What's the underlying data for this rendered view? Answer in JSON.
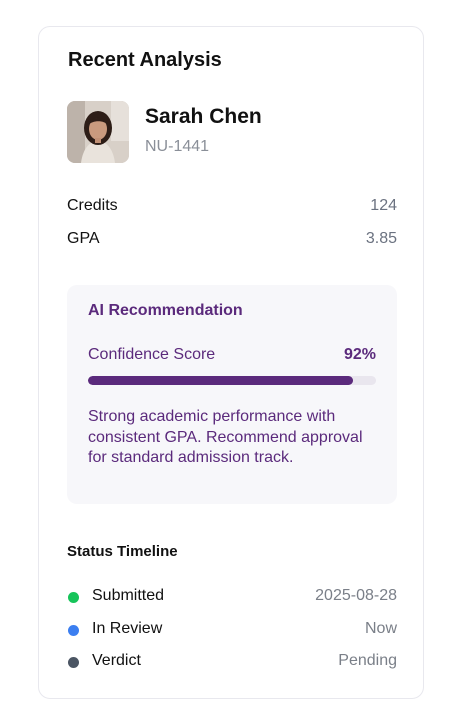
{
  "card": {
    "title": "Recent Analysis"
  },
  "student": {
    "name": "Sarah Chen",
    "id": "NU-1441",
    "avatar_icon": "student-photo"
  },
  "stats": [
    {
      "label": "Credits",
      "value": "124"
    },
    {
      "label": "GPA",
      "value": "3.85"
    }
  ],
  "ai_recommendation": {
    "title": "AI Recommendation",
    "confidence_label": "Confidence Score",
    "confidence_value": "92%",
    "confidence_fraction": 0.92,
    "text": "Strong academic performance with consistent GPA. Recommend approval for standard admission track."
  },
  "timeline": {
    "title": "Status Timeline",
    "items": [
      {
        "label": "Submitted",
        "value": "2025-08-28",
        "color": "#16c45a"
      },
      {
        "label": "In Review",
        "value": "Now",
        "color": "#3b7ef0"
      },
      {
        "label": "Verdict",
        "value": "Pending",
        "color": "#4b5563"
      }
    ]
  },
  "colors": {
    "accent": "#5b2a7c",
    "panel_bg": "#f7f7fa"
  }
}
